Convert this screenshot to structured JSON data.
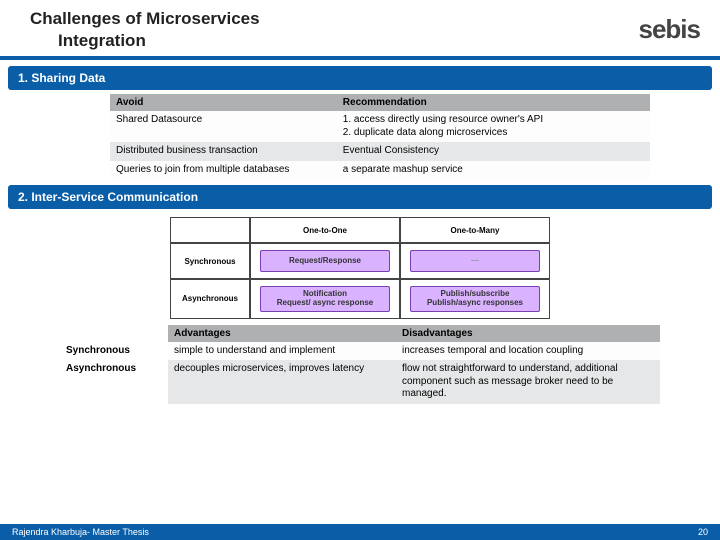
{
  "header": {
    "title_line1": "Challenges of Microservices",
    "title_line2": "Integration",
    "logo": "sebis"
  },
  "section1": {
    "heading": "1. Sharing Data",
    "table": {
      "head": {
        "c1": "Avoid",
        "c2": "Recommendation"
      },
      "rows": [
        {
          "c1": "Shared Datasource",
          "c2": "1. access directly using resource owner's API\n2. duplicate data along microservices"
        },
        {
          "c1": "Distributed business transaction",
          "c2": "Eventual Consistency"
        },
        {
          "c1": "Queries to join from multiple databases",
          "c2": "a separate mashup service"
        }
      ]
    }
  },
  "section2": {
    "heading": "2. Inter-Service Communication",
    "diagram": {
      "top": {
        "blank": "",
        "col1": "One-to-One",
        "col2": "One-to-Many"
      },
      "row1": {
        "label": "Synchronous",
        "cell1": "Request/Response",
        "cell2": "—"
      },
      "row2": {
        "label": "Asynchronous",
        "cell1a": "Notification",
        "cell1b": "Request/ async response",
        "cell2a": "Publish/subscribe",
        "cell2b": "Publish/async responses"
      }
    },
    "table": {
      "head": {
        "c0": "",
        "c1": "Advantages",
        "c2": "Disadvantages"
      },
      "rows": [
        {
          "c0": "Synchronous",
          "c1": "simple to understand and implement",
          "c2": "increases temporal and location coupling"
        },
        {
          "c0": "Asynchronous",
          "c1": "decouples microservices, improves latency",
          "c2": "flow not straightforward to understand, additional component such as message broker need to be managed."
        }
      ]
    }
  },
  "footer": {
    "left": "Rajendra Kharbuja- Master Thesis",
    "right": "20"
  }
}
